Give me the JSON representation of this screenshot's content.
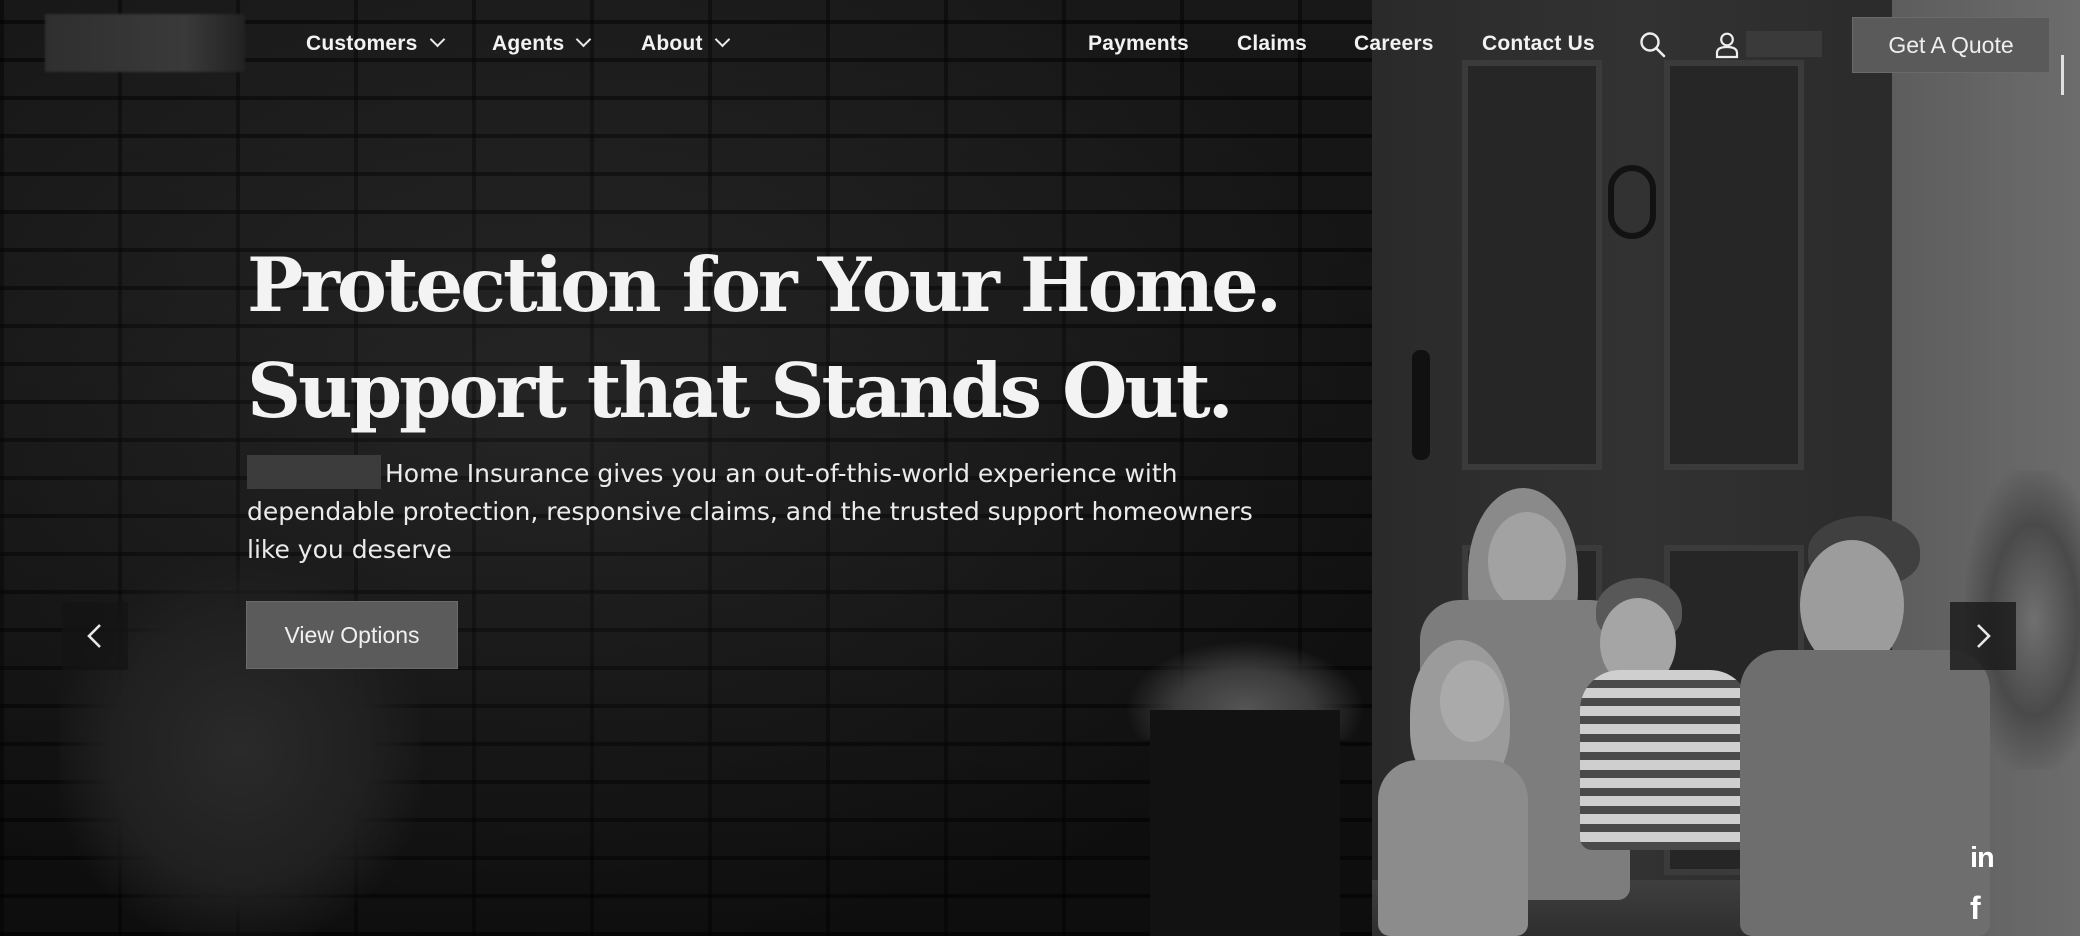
{
  "nav": {
    "menu": [
      {
        "label": "Customers",
        "dropdown": true
      },
      {
        "label": "Agents",
        "dropdown": true
      },
      {
        "label": "About",
        "dropdown": true
      }
    ],
    "links": [
      "Payments",
      "Claims",
      "Careers",
      "Contact Us"
    ],
    "icons": {
      "search": "search-icon",
      "account": "user-icon"
    },
    "cta_label": "Get A Quote"
  },
  "hero": {
    "heading_line1": "Protection for Your Home.",
    "heading_line2": "Support that Stands Out.",
    "body": "Home Insurance gives you an out-of-this-world experience with dependable protection, responsive claims, and the trusted support homeowners like you deserve",
    "cta_label": "View Options"
  },
  "carousel": {
    "prev_icon": "chevron-left-icon",
    "next_icon": "chevron-right-icon"
  },
  "social": {
    "linkedin": "in",
    "facebook": "f"
  }
}
